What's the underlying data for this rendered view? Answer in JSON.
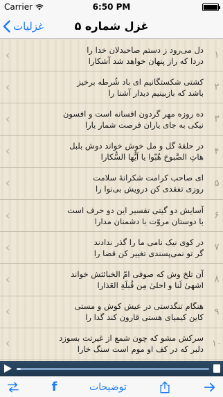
{
  "status_bar": {
    "carrier": "Carrier",
    "time": "6:50 PM"
  },
  "nav": {
    "title": "غزل شماره ۵",
    "back_label": "غزلیات"
  },
  "poems": [
    {
      "number": "۱",
      "line1": "دل می‌رود ز دستم صاحبدلان خدا را",
      "line2": "دردا که راز پنهان خواهد شد آشکارا"
    },
    {
      "number": "۲",
      "line1": "کشتی شکستگانیم ای باد شُرطه برخیز",
      "line2": "باشد که بازبینیم دیدار آشنا را"
    },
    {
      "number": "۳",
      "line1": "ده روزه مهر گردون افسانه است و افسون",
      "line2": "نیکی به جای یاران فرصت شمار یارا"
    },
    {
      "number": "۴",
      "line1": "در حلقهٔ گل و مل خوش خواند دوش بلبل",
      "line2": "هاتِ الصَّبوحَ هُبّوا یا اَیُّها السُّکارا"
    },
    {
      "number": "۵",
      "line1": "ای صاحب کرامت شکرانهٔ سلامت",
      "line2": "روزی تفقدی کن درویش بی‌نوا را"
    },
    {
      "number": "۶",
      "line1": "آسایش دو گیتی تفسیر این دو حرف است",
      "line2": "با دوستان مروّت با دشمنان مدارا"
    },
    {
      "number": "۷",
      "line1": "در کوی نیک نامی ما را گذر ندادند",
      "line2": "گر تو نمی‌پسندی تغییر کن قضا را"
    },
    {
      "number": "۸",
      "line1": "آن تلخ وش که صوفی امّ الخبائثش خواند",
      "line2": "اشهیٰ لَنا و احلیٰ مِن قُبلَةِ العَذارا"
    },
    {
      "number": "۹",
      "line1": "هنگام تنگدستی در عیش کوش و مستی",
      "line2": "کاین کیمیای هستی قارون کند گدا را"
    },
    {
      "number": "۱۰",
      "line1": "سرکش مشو که چون شمع از غیرتت بسوزد",
      "line2": "دلبر که در کف او موم است سنگ خارا"
    }
  ],
  "player": {
    "progress": 0.02
  },
  "toolbar": {
    "notes_label": "توضیحات",
    "facebook_glyph": "f"
  },
  "colors": {
    "accent": "#1a7cf4",
    "player_bg": "#203850"
  }
}
